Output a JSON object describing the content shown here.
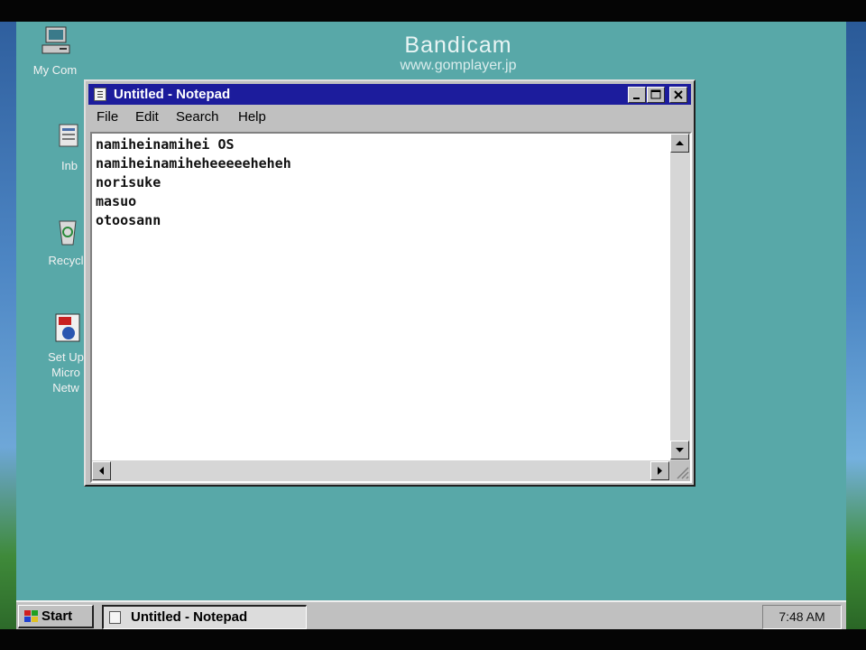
{
  "recording_watermark": {
    "title": "Bandicam",
    "url": "www.gomplayer.jp"
  },
  "desktop": {
    "background_color": "#58a8a8",
    "icons": [
      {
        "label": "My Com",
        "icon": "my-computer-icon"
      },
      {
        "label": "Inb",
        "icon": "inbox-icon"
      },
      {
        "label": "Recycl",
        "icon": "recycle-bin-icon"
      },
      {
        "label": "Set Up\nMicro\nNetw",
        "icon": "msn-setup-icon"
      }
    ]
  },
  "notepad": {
    "title": "Untitled - Notepad",
    "title_bar_color": "#1c1c9c",
    "menu": [
      "File",
      "Edit",
      "Search",
      "Help"
    ],
    "content_lines": [
      "namiheinamihei OS",
      "namiheinamiheheeeeeheheh",
      "norisuke",
      "masuo",
      "otoosann"
    ]
  },
  "taskbar": {
    "start_label": "Start",
    "task_button_label": "Untitled - Notepad",
    "clock": "7:48 AM"
  }
}
